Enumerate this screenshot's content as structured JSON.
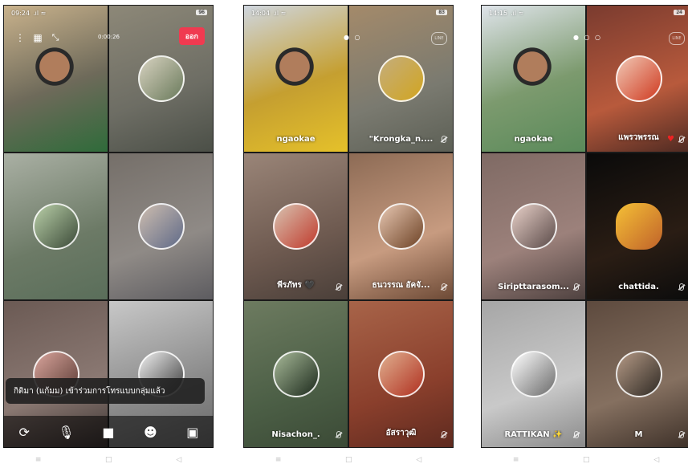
{
  "phone1": {
    "status_time": "09:24",
    "battery": "96",
    "timer": "0:00:26",
    "leave_label": "ออก",
    "toast": "กิติมา (แก้มม) เข้าร่วมการโทรแบบกลุ่มแล้ว",
    "tiles": [
      {
        "name": "",
        "bg": "linear-gradient(160deg,#c9b28c,#6e6a5a 55%,#2f6b3a)",
        "self": true
      },
      {
        "name": "",
        "bg": "linear-gradient(160deg,#8d8878,#6d6d64 60%,#4b4f47)",
        "avatar": "linear-gradient(135deg,#d7d2c0,#6a7a5b)"
      },
      {
        "name": "",
        "bg": "linear-gradient(160deg,#aab0a4,#6c7a66 60%,#5a6e5a)",
        "avatar": "linear-gradient(135deg,#b9cfa8,#3b4a38)"
      },
      {
        "name": "",
        "bg": "linear-gradient(160deg,#756f69,#8f8a86 60%,#5d5c60)",
        "avatar": "linear-gradient(135deg,#cdbdaf,#5f6a88)"
      },
      {
        "name": "",
        "bg": "linear-gradient(160deg,#6b5a54,#8a7872 60%,#3b3331)",
        "avatar": "linear-gradient(135deg,#d9a59c,#5a3a34)"
      },
      {
        "name": "",
        "bg": "linear-gradient(160deg,#c8c8c8,#8a8a8a 60%,#6a6a6a)",
        "avatar": "linear-gradient(135deg,#f0f0f0,#3b3b3b)"
      }
    ]
  },
  "phone2": {
    "status_time": "14:04",
    "battery": "83",
    "line_badge": "LINE",
    "tiles": [
      {
        "name": "ngaokae",
        "bg": "linear-gradient(160deg,#cfd6df,#c59f30 55%,#e5c12a)",
        "self": true
      },
      {
        "name": "\"Krongka_n....",
        "bg": "linear-gradient(160deg,#a48a6a,#7a7a70 60%,#5c5f55)",
        "avatar": "linear-gradient(135deg,#c4ad7c,#d1a520)"
      },
      {
        "name": "พีรภัทร 🖤",
        "bg": "linear-gradient(160deg,#9a8578,#6e5a50 60%,#4a3f39)",
        "avatar": "linear-gradient(135deg,#d8c2b0,#c03a2c)"
      },
      {
        "name": "ธนวรรณ อัคจั...",
        "bg": "linear-gradient(160deg,#8d6b55,#c79b80 60%,#6d4a36)",
        "avatar": "linear-gradient(135deg,#e7c7b2,#6d4225)"
      },
      {
        "name": "Nisachon_.",
        "bg": "linear-gradient(160deg,#6d7b60,#4c5f46 60%,#3b4a36)",
        "avatar": "linear-gradient(135deg,#a7b998,#1c2a1c)"
      },
      {
        "name": "อัสราวุฒิ",
        "bg": "linear-gradient(160deg,#a86449,#8a3f2c 60%,#5e2a1f)",
        "avatar": "linear-gradient(135deg,#e0b090,#b03020)"
      }
    ]
  },
  "phone3": {
    "status_time": "14:15",
    "battery": "24",
    "line_badge": "LINE",
    "tiles": [
      {
        "name": "ngaokae",
        "bg": "linear-gradient(160deg,#dfe4ea,#7c9a6e 55%,#5a8a5a)",
        "self": true
      },
      {
        "name": "แพรวพรรณ",
        "heart": true,
        "bg": "linear-gradient(160deg,#7a3b2f,#b85a3c 60%,#4e2a22)",
        "avatar": "linear-gradient(135deg,#f1c8b5,#cf3a20)"
      },
      {
        "name": "Siripttarasom...",
        "bg": "linear-gradient(160deg,#7f6a64,#9c817b 60%,#4f4240)",
        "avatar": "linear-gradient(135deg,#e8d0c8,#5a4a48)"
      },
      {
        "name": "chattida.",
        "bg": "linear-gradient(160deg,#0a0a0a,#2a1d14 60%,#0c0c0c)",
        "avatar": "linear-gradient(135deg,#f5c036,#c0622a)",
        "no_circle": true
      },
      {
        "name": "RATTIKAN ✨",
        "bg": "linear-gradient(160deg,#a6a6a6,#c9c9c9 60%,#8a8a8a)",
        "avatar": "linear-gradient(135deg,#ffffff,#6a6a6a)"
      },
      {
        "name": "M",
        "bg": "linear-gradient(160deg,#5d4a3e,#857060 60%,#3e3129)",
        "avatar": "linear-gradient(135deg,#b59a86,#2f2a24)"
      }
    ]
  },
  "navbar": [
    "≡",
    "□",
    "◁"
  ]
}
